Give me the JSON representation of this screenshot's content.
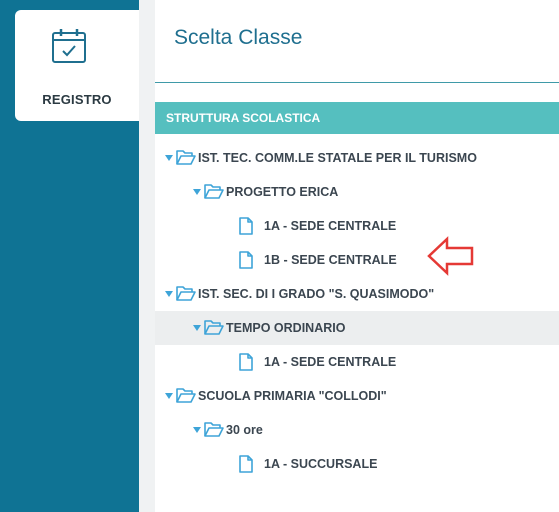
{
  "sidebar": {
    "tab_label": "REGISTRO"
  },
  "page": {
    "title": "Scelta Classe"
  },
  "tree": {
    "header": "STRUTTURA SCOLASTICA",
    "items": [
      {
        "label": "IST. TEC. COMM.LE STATALE PER IL TURISMO"
      },
      {
        "label": "PROGETTO ERICA"
      },
      {
        "label": "1A - SEDE CENTRALE"
      },
      {
        "label": "1B - SEDE CENTRALE"
      },
      {
        "label": "IST. SEC. DI I GRADO \"S. QUASIMODO\""
      },
      {
        "label": "TEMPO ORDINARIO"
      },
      {
        "label": "1A - SEDE CENTRALE"
      },
      {
        "label": "SCUOLA PRIMARIA \"COLLODI\""
      },
      {
        "label": "30 ore"
      },
      {
        "label": "1A - SUCCURSALE"
      }
    ]
  },
  "colors": {
    "sidebar": "#0f7394",
    "header": "#55bfbf",
    "accent": "#3ea4d8",
    "annotation_arrow": "#e53935"
  }
}
